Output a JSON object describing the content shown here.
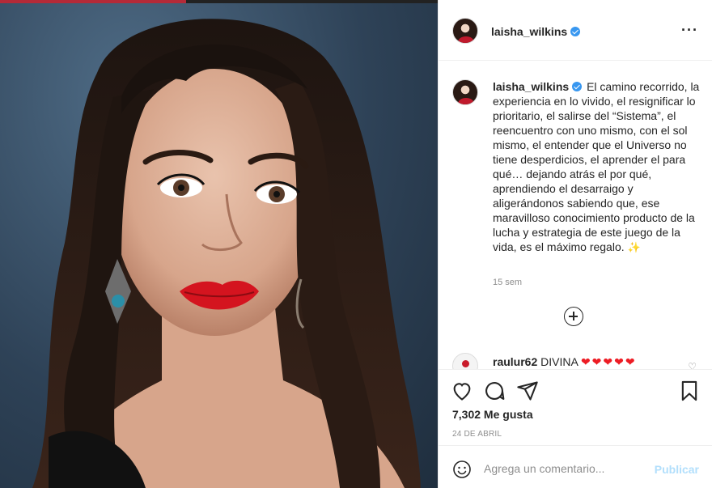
{
  "post": {
    "username": "laisha_wilkins",
    "caption": "El camino recorrido, la experiencia en lo vivido, el resignificar lo prioritario, el salirse del “Sistema”, el reencuentro con uno mismo, con el sol mismo, el entender que el Universo no tiene desperdicios, el aprender el para qué… dejando atrás el por qué, aprendiendo el desarraigo y aligerándonos sabiendo que, ese maravilloso conocimiento producto de la lucha y estrategia de este juego de la vida, es el máximo regalo.",
    "caption_emoji": "✨",
    "time_ago": "15 sem",
    "likes": "7,302 Me gusta",
    "date": "24 DE ABRIL"
  },
  "comments": [
    {
      "username": "raulur62",
      "text": "DIVINA",
      "hearts": "❤❤❤❤❤"
    }
  ],
  "composer": {
    "placeholder": "Agrega un comentario...",
    "publish_label": "Publicar"
  },
  "icons": {
    "more": "more-options-icon",
    "like": "heart-icon",
    "comment": "comment-icon",
    "share": "share-icon",
    "save": "bookmark-icon",
    "emoji": "emoji-icon",
    "load_more": "plus-circle-icon"
  },
  "colors": {
    "verified": "#3897f0",
    "publish_disabled": "#b2dffc",
    "heart": "#ed1c24",
    "lipstick": "#d4141f"
  }
}
